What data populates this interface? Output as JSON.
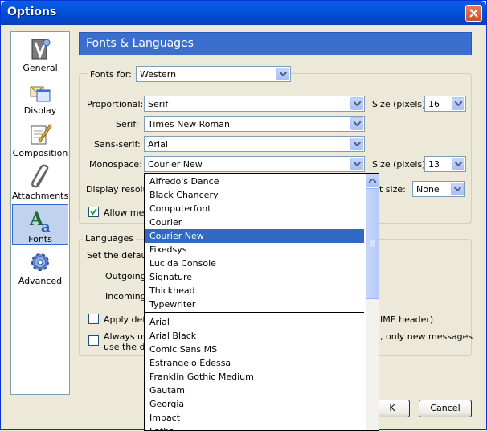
{
  "window": {
    "title": "Options"
  },
  "sidebar": {
    "items": [
      {
        "label": "General",
        "icon": "general-icon"
      },
      {
        "label": "Display",
        "icon": "display-icon"
      },
      {
        "label": "Composition",
        "icon": "composition-icon"
      },
      {
        "label": "Attachments",
        "icon": "attachments-icon"
      },
      {
        "label": "Fonts",
        "icon": "fonts-icon",
        "selected": true
      },
      {
        "label": "Advanced",
        "icon": "advanced-icon"
      }
    ]
  },
  "pane": {
    "title": "Fonts & Languages",
    "fonts_group": {
      "fonts_for_label": "Fonts for:",
      "fonts_for_value": "Western",
      "proportional_label": "Proportional:",
      "proportional_value": "Serif",
      "size_label_1": "Size (pixels)",
      "size_value_1": "16",
      "serif_label": "Serif:",
      "serif_value": "Times New Roman",
      "sans_serif_label": "Sans-serif:",
      "sans_serif_value": "Arial",
      "monospace_label": "Monospace:",
      "monospace_value": "Courier New",
      "size_label_2": "Size (pixels)",
      "size_value_2": "13",
      "display_resolution_label": "Display resolutio",
      "min_size_label_fragment": "nt size:",
      "min_size_value": "None",
      "allow_label": "Allow mess"
    },
    "languages_group": {
      "legend": "Languages",
      "set_default_label": "Set the default",
      "outgoing_label": "Outgoing",
      "incoming_label": "Incoming M",
      "apply_label": "Apply defa",
      "mime_fragment": "IME header)",
      "always_label_1": "Always us",
      "always_label_2": "use the de",
      "only_new_fragment": ", only new messages"
    }
  },
  "dropdown": {
    "group1": [
      "Alfredo's Dance",
      "Black Chancery",
      "Computerfont",
      "Courier",
      "Courier New",
      "Fixedsys",
      "Lucida Console",
      "Signature",
      "Thickhead",
      "Typewriter"
    ],
    "selected": "Courier New",
    "group2": [
      "Arial",
      "Arial Black",
      "Comic Sans MS",
      "Estrangelo Edessa",
      "Franklin Gothic Medium",
      "Gautami",
      "Georgia",
      "Impact",
      "Latha"
    ]
  },
  "buttons": {
    "ok_fragment": "K",
    "cancel": "Cancel"
  },
  "colors": {
    "title_bar": "#0453db",
    "selection": "#316ac5",
    "header": "#3a6fd0"
  }
}
